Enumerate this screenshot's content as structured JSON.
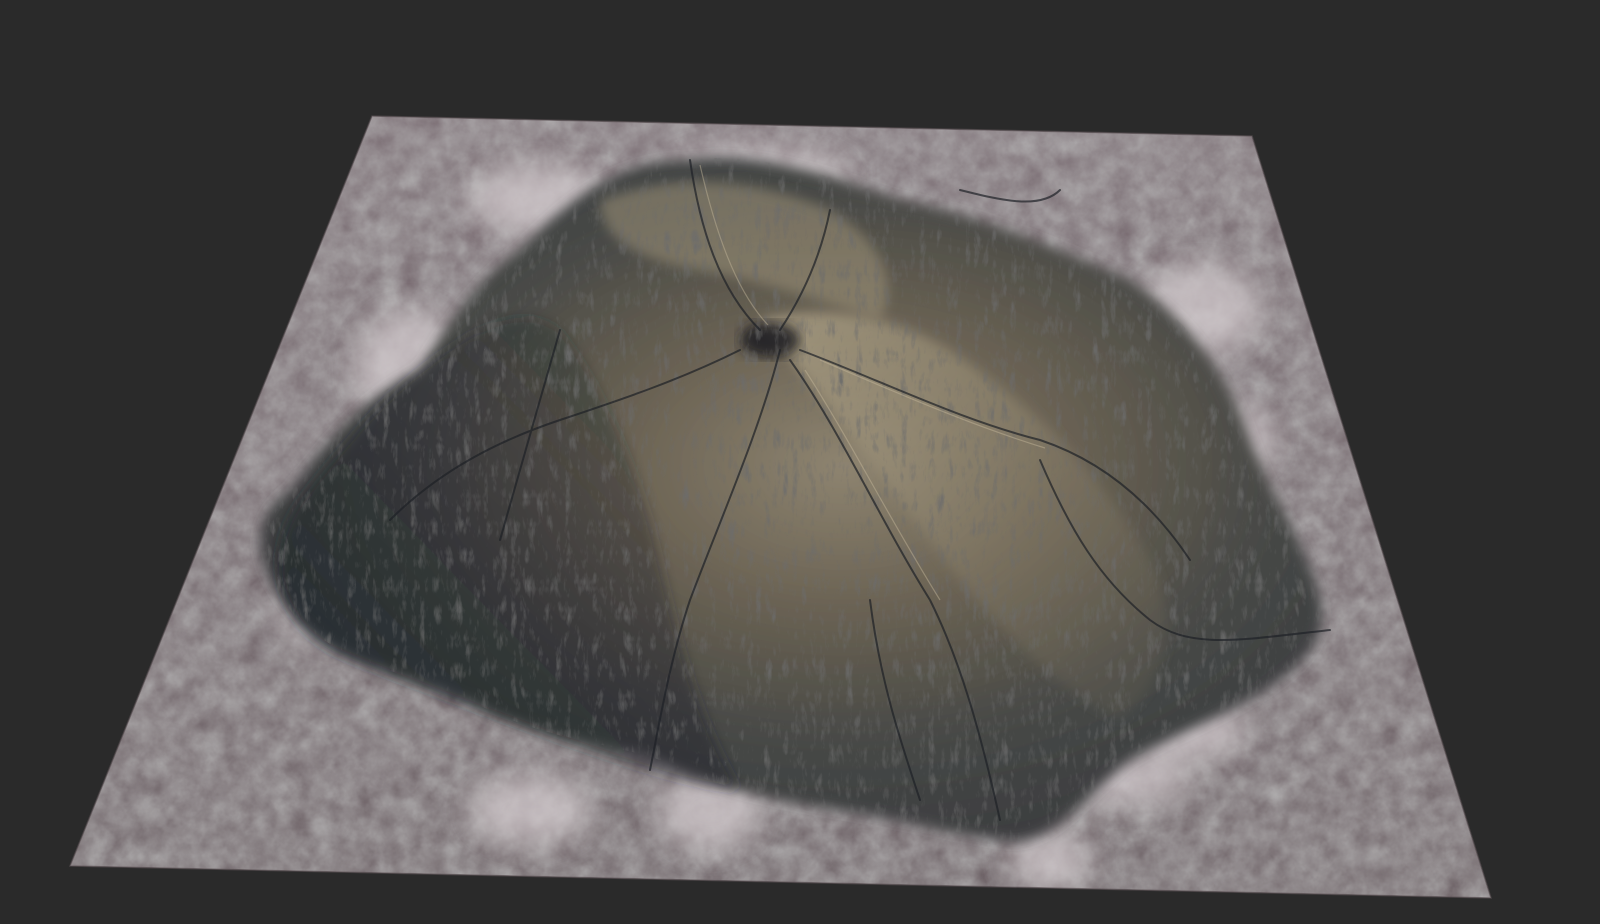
{
  "viewport": {
    "background_color": "#2a2a2a"
  },
  "terrain": {
    "subject": "terrain-heightfield-render",
    "plain_color": "#7a6e72",
    "plain_highlight_color": "#b9aeb2",
    "snow_color": "#d8d2d4",
    "mountain_shadow_color": "#2e3238",
    "mountain_mid_color": "#5b5548",
    "mountain_light_color": "#a99c80"
  }
}
